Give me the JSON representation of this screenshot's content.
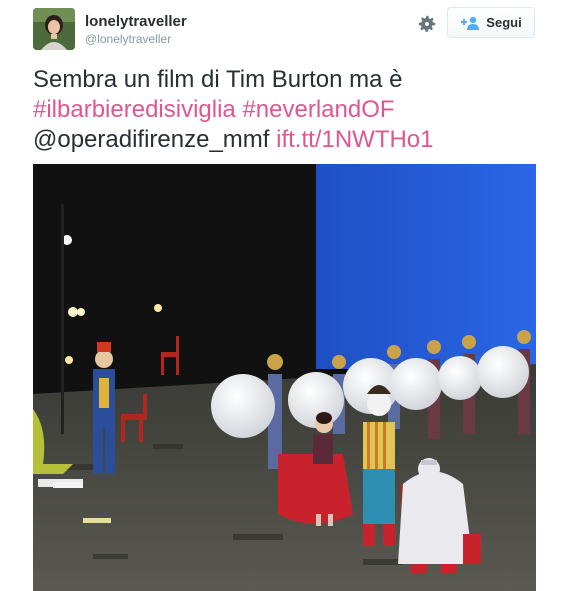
{
  "user": {
    "display_name": "lonelytraveller",
    "handle": "@lonelytraveller"
  },
  "header": {
    "follow_label": "Segui",
    "icons": {
      "settings": "gear-icon",
      "follow": "add-user-icon"
    }
  },
  "tweet": {
    "text_start": "Sembra un film di Tim Burton ma è",
    "hashtag_1": "#ilbarbieredisiviglia",
    "hashtag_2": "#neverlandOF",
    "mention": "@operadifirenze_mmf",
    "link": "ift.tt/1NWTHo1"
  },
  "colors": {
    "accent": "#e0578f",
    "text": "#292f33",
    "muted": "#8899a6"
  }
}
